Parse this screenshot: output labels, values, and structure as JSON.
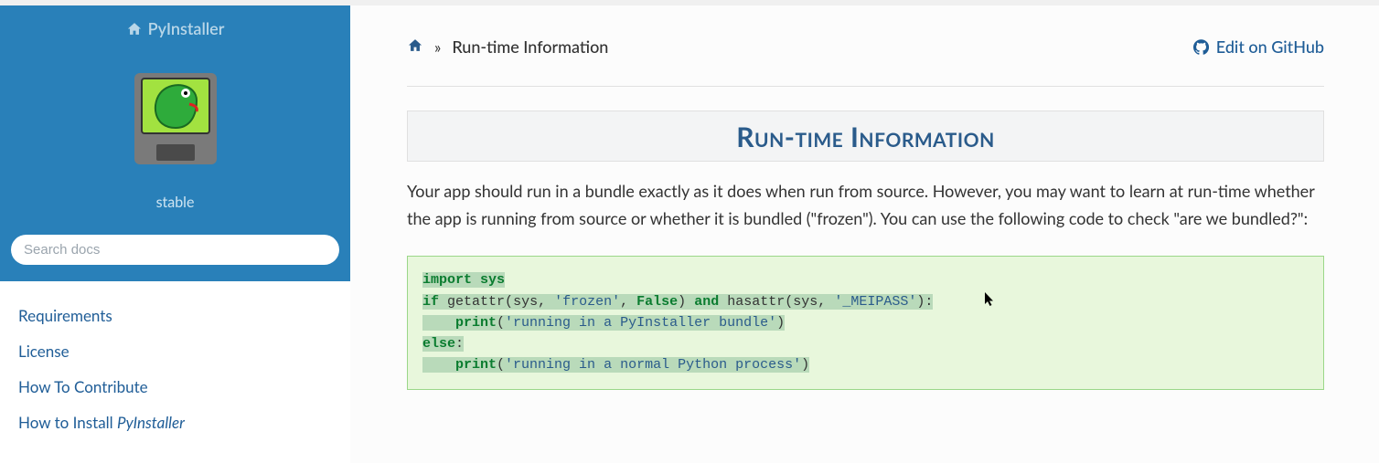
{
  "brand": {
    "name": "PyInstaller"
  },
  "version": "stable",
  "search": {
    "placeholder": "Search docs"
  },
  "nav": {
    "items": [
      "Requirements",
      "License",
      "How To Contribute",
      "How to Install <em>PyInstaller</em>"
    ]
  },
  "breadcrumb": {
    "separator": "»",
    "current": "Run-time Information"
  },
  "edit": {
    "label": "Edit on GitHub"
  },
  "title": "Run-time Information",
  "paragraph": "Your app should run in a bundle exactly as it does when run from source. However, you may want to learn at run-time whether the app is running from source or whether it is bundled (\"frozen\"). You can use the following code to check \"are we bundled?\":",
  "code": {
    "lines": [
      [
        {
          "t": "import",
          "c": "kw",
          "hi": true
        },
        {
          "t": " ",
          "hi": true
        },
        {
          "t": "sys",
          "c": "kw",
          "hi": true
        }
      ],
      [
        {
          "t": "if",
          "c": "kw",
          "hi": true
        },
        {
          "t": " ",
          "hi": true
        },
        {
          "t": "getattr",
          "hi": true
        },
        {
          "t": "(",
          "hi": true
        },
        {
          "t": "sys",
          "hi": true
        },
        {
          "t": ",",
          "hi": true
        },
        {
          "t": " ",
          "hi": true
        },
        {
          "t": "'frozen'",
          "c": "str",
          "hi": true
        },
        {
          "t": ",",
          "hi": true
        },
        {
          "t": " ",
          "hi": true
        },
        {
          "t": "False",
          "c": "bool",
          "hi": true
        },
        {
          "t": ")",
          "hi": true
        },
        {
          "t": " ",
          "hi": true
        },
        {
          "t": "and",
          "c": "kw",
          "hi": true
        },
        {
          "t": " ",
          "hi": true
        },
        {
          "t": "hasattr",
          "hi": true
        },
        {
          "t": "(",
          "hi": true
        },
        {
          "t": "sys",
          "hi": true
        },
        {
          "t": ",",
          "hi": true
        },
        {
          "t": " ",
          "hi": true
        },
        {
          "t": "'_MEIPASS'",
          "c": "str",
          "hi": true
        },
        {
          "t": ")",
          "hi": true
        },
        {
          "t": ":",
          "hi": true
        }
      ],
      [
        {
          "t": "    ",
          "hi": true
        },
        {
          "t": "print",
          "c": "kw",
          "hi": true
        },
        {
          "t": "(",
          "hi": true
        },
        {
          "t": "'running in a PyInstaller bundle'",
          "c": "str",
          "hi": true
        },
        {
          "t": ")",
          "hi": true
        }
      ],
      [
        {
          "t": "else",
          "c": "kw",
          "hi": true
        },
        {
          "t": ":",
          "hi": true
        }
      ],
      [
        {
          "t": "    ",
          "hi": true
        },
        {
          "t": "print",
          "c": "kw",
          "hi": true
        },
        {
          "t": "(",
          "hi": true
        },
        {
          "t": "'running in a normal Python process'",
          "c": "str",
          "hi": true
        },
        {
          "t": ")",
          "hi": true
        }
      ]
    ]
  }
}
